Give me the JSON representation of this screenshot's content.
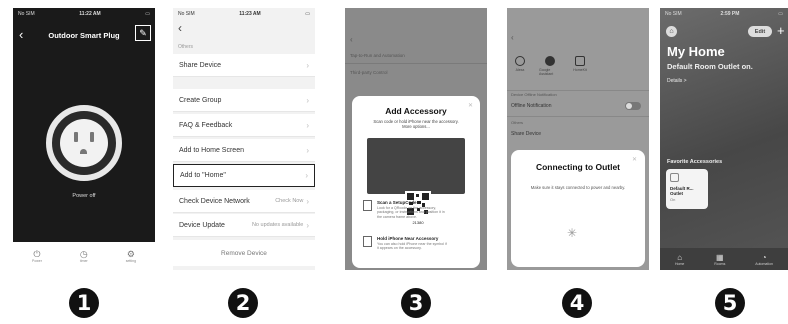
{
  "steps": [
    "1",
    "2",
    "3",
    "4",
    "5"
  ],
  "screen1": {
    "status": {
      "carrier": "No SIM",
      "time": "11:22 AM"
    },
    "title": "Outdoor Smart Plug",
    "power_state": "Power off",
    "tabs": [
      {
        "label": "Power",
        "icon": "power-icon"
      },
      {
        "label": "timer",
        "icon": "clock-icon"
      },
      {
        "label": "setting",
        "icon": "gear-icon"
      }
    ]
  },
  "screen2": {
    "status": {
      "carrier": "No SIM",
      "time": "11:23 AM"
    },
    "section": "Others",
    "rows": [
      {
        "label": "Share Device",
        "value": ""
      },
      {
        "label": "Create Group",
        "value": ""
      },
      {
        "label": "FAQ & Feedback",
        "value": ""
      },
      {
        "label": "Add to Home Screen",
        "value": ""
      },
      {
        "label": "Add to \"Home\"",
        "value": ""
      },
      {
        "label": "Check Device Network",
        "value": "Check Now"
      },
      {
        "label": "Device Update",
        "value": "No updates available"
      }
    ],
    "remove_label": "Remove Device"
  },
  "screen3": {
    "bg_rows": [
      "Tap-to-Run and Automation",
      "Third-party Control"
    ],
    "title": "Add Accessory",
    "subtitle": "Scan code or hold iPhone near the accessory. More options...",
    "code_number": "21380",
    "options": [
      {
        "heading": "Scan a SetupCode",
        "desc": "Look for a QRcode on the accessory, packaging, or instructions and position it in the camera frame above.",
        "icon": "qr-code-icon"
      },
      {
        "heading": "Hold iPhone Near Accessory",
        "desc": "You can also hold iPhone near the symbol if it appears on the accessory.",
        "icon": "nfc-icon"
      }
    ]
  },
  "screen4": {
    "icons": [
      {
        "label": "Alexa",
        "icon": "alexa-icon"
      },
      {
        "label": "Google Assistant",
        "icon": "google-assistant-icon"
      },
      {
        "label": "HomeKit",
        "icon": "homekit-icon"
      }
    ],
    "section1": "Device Offline Notification",
    "offline_label": "Offline Notification",
    "section2": "Others",
    "share_label": "Share Device",
    "modal_title": "Connecting to Outlet",
    "modal_sub": "Make sure it stays connected to power and nearby."
  },
  "screen5": {
    "status": {
      "carrier": "No SIM",
      "time": "2:59 PM"
    },
    "edit_label": "Edit",
    "title": "My Home",
    "status_text": "Default Room Outlet on.",
    "details": "Details >",
    "favorites": "Favorite Accessories",
    "tile": {
      "name": "Default R... Outlet",
      "state": "On"
    },
    "tabs": [
      {
        "label": "Home",
        "icon": "house-icon"
      },
      {
        "label": "Rooms",
        "icon": "rooms-icon"
      },
      {
        "label": "Automation",
        "icon": "automation-icon"
      }
    ]
  }
}
